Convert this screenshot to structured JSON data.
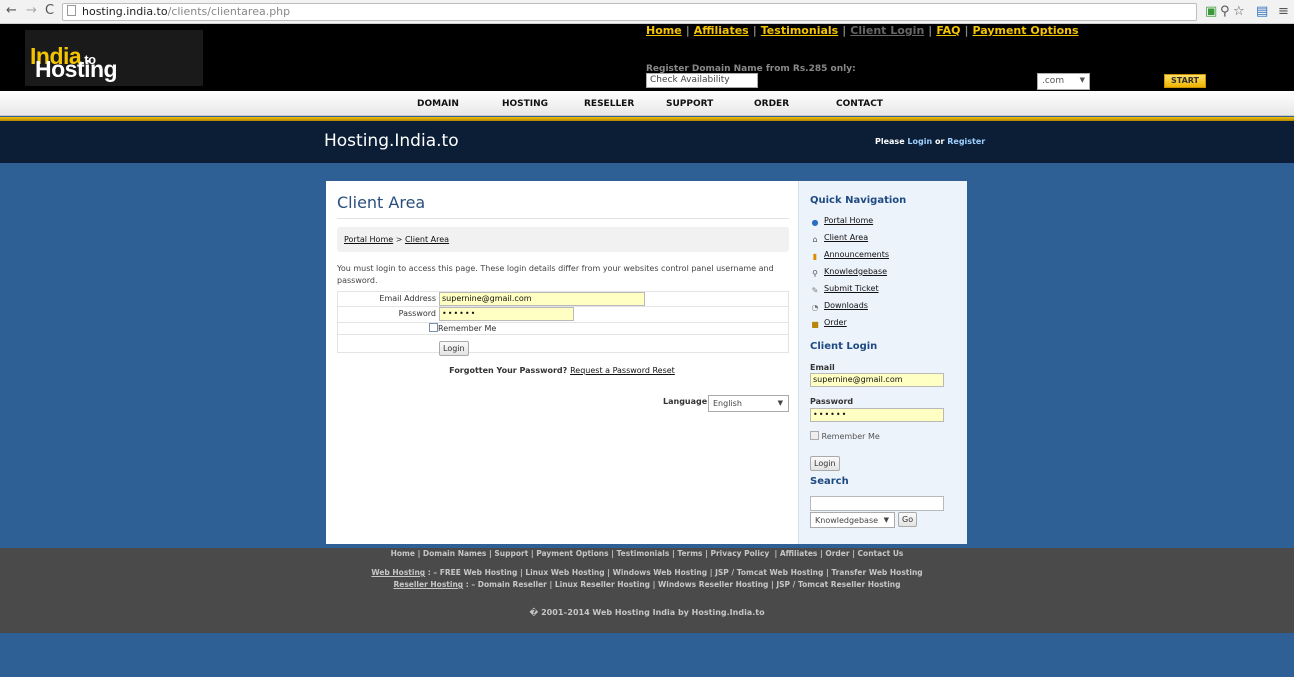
{
  "browser": {
    "url_host": "hosting.india.to",
    "url_path": "/clients/clientarea.php"
  },
  "header": {
    "logo_main": "Hosting",
    "logo_accent": "India",
    "logo_suffix": ".to",
    "topnav": [
      "Home",
      "Affiliates",
      "Testimonials",
      "Client Login",
      "FAQ",
      "Payment Options"
    ],
    "register_label": "Register Domain Name from Rs.285 only:",
    "check_placeholder": "Check Availability",
    "tld_value": ".com",
    "start_label": "START"
  },
  "mainnav": [
    "DOMAIN",
    "HOSTING",
    "RESELLER",
    "SUPPORT",
    "ORDER",
    "CONTACT"
  ],
  "banner": {
    "site_title": "Hosting.India.to",
    "welcome_prefix": "Please",
    "login_link": "Login",
    "or_text": "or",
    "register_link": "Register"
  },
  "main": {
    "page_title": "Client Area",
    "breadcrumb": [
      "Portal Home",
      "Client Area"
    ],
    "breadcrumb_sep": ">",
    "intro": "You must login to access this page. These login details differ from your websites control panel username and password.",
    "email_label": "Email Address",
    "email_value": "supernine@gmail.com",
    "password_label": "Password",
    "password_value": "••••••",
    "remember_label": "Remember Me",
    "login_button": "Login",
    "forgot_text": "Forgotten Your Password?",
    "forgot_link": "Request a Password Reset",
    "language_label": "Language:",
    "language_value": "English"
  },
  "sidebar": {
    "quicknav_title": "Quick Navigation",
    "quicknav": [
      {
        "label": "Portal Home",
        "icon": "globe-icon"
      },
      {
        "label": "Client Area",
        "icon": "home-icon"
      },
      {
        "label": "Announcements",
        "icon": "announcement-icon"
      },
      {
        "label": "Knowledgebase",
        "icon": "magnifier-icon"
      },
      {
        "label": "Submit Ticket",
        "icon": "ticket-icon"
      },
      {
        "label": "Downloads",
        "icon": "download-icon"
      },
      {
        "label": "Order",
        "icon": "box-icon"
      }
    ],
    "client_login_title": "Client Login",
    "email_label": "Email",
    "email_value": "supernine@gmail.com",
    "password_label": "Password",
    "password_value": "••••••",
    "remember_label": "Remember Me",
    "login_button": "Login",
    "search_title": "Search",
    "search_value": "",
    "search_scope": "Knowledgebase",
    "go_button": "Go"
  },
  "footer": {
    "row1": [
      "Home",
      "Domain Names",
      "Support",
      "Payment Options",
      "Testimonials",
      "Terms",
      "Privacy Policy",
      "Affiliates",
      "Order",
      "Contact Us"
    ],
    "row2_lead": "Web Hosting",
    "row2_rest": ": –  FREE Web Hosting | Linux Web Hosting | Windows Web Hosting | JSP / Tomcat Web Hosting | Transfer Web Hosting",
    "row3_lead": "Reseller Hosting",
    "row3_rest": ": – Domain Reseller | Linux Reseller Hosting | Windows Reseller Hosting | JSP / Tomcat Reseller Hosting",
    "copyright": "� 2001–2014 Web Hosting India by Hosting.India.to"
  }
}
